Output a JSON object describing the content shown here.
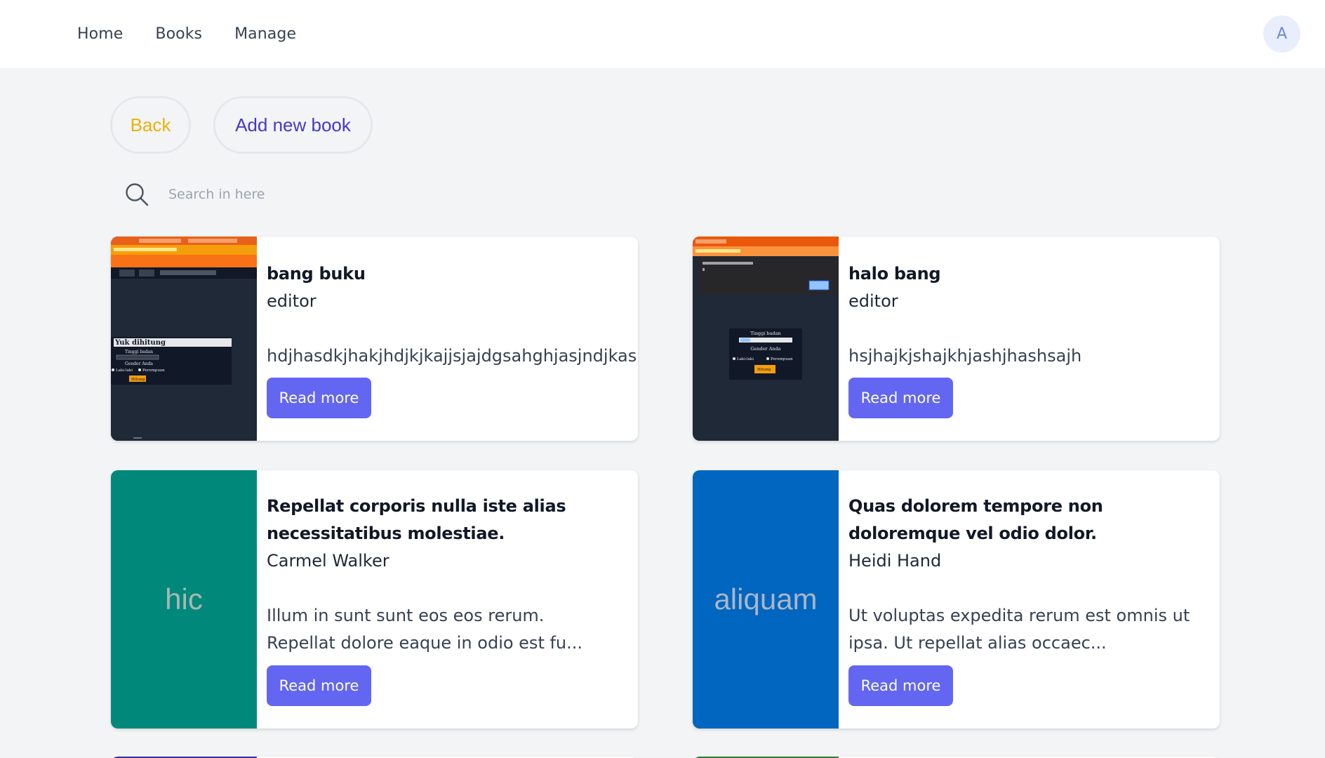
{
  "nav": {
    "links": [
      "Home",
      "Books",
      "Manage"
    ],
    "avatar_initial": "A"
  },
  "actions": {
    "back_label": "Back",
    "add_label": "Add new book"
  },
  "search": {
    "placeholder": "Search in here",
    "value": ""
  },
  "books": [
    {
      "title": "bang buku",
      "author": "editor",
      "description": "hdjhasdkjhakjhdjkjkajjsjajdgsahghjasjndjkashgdjhasgdjhasgdjhasgd",
      "read_more": "Read more",
      "cover": "screenshot",
      "cover_text": {
        "heading": "Yuk dihitung",
        "field1": "Tinggi badan",
        "field2": "Gender Anda",
        "opt1": "Laki-laki",
        "opt2": "Perempuan",
        "btn": "Hitung"
      }
    },
    {
      "title": "halo bang",
      "author": "editor",
      "description": "hsjhajkjshajkhjashjhashsajh",
      "read_more": "Read more",
      "cover": "screenshot",
      "cover_text": {
        "field1": "Tinggi badan",
        "field2": "Gender Anda",
        "opt1": "Laki-laki",
        "opt2": "Perempuan",
        "btn": "Hitung"
      }
    },
    {
      "title": "Repellat corporis nulla iste alias necessitatibus molestiae.",
      "author": "Carmel Walker",
      "description": "Illum in sunt sunt eos eos rerum. Repellat dolore eaque in odio est fu...",
      "read_more": "Read more",
      "cover": "placeholder",
      "cover_word": "hic",
      "cover_color": "#00897b"
    },
    {
      "title": "Quas dolorem tempore non doloremque vel odio dolor.",
      "author": "Heidi Hand",
      "description": "Ut voluptas expedita rerum est omnis ut ipsa. Ut repellat alias occaec...",
      "read_more": "Read more",
      "cover": "placeholder",
      "cover_word": "aliquam",
      "cover_color": "#0066bf"
    }
  ],
  "colors": {
    "accent": "#6366f1",
    "back": "#eab308",
    "add": "#4338ca",
    "page_bg": "#f3f4f6",
    "next_row_left": "#3730a3",
    "next_row_right": "#2e7d32"
  }
}
